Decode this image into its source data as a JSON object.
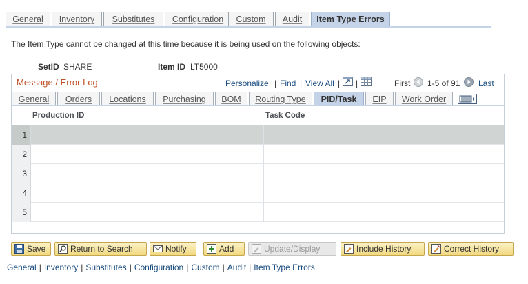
{
  "page_tabs": [
    "General",
    "Inventory",
    "Substitutes",
    "Configuration",
    "Custom",
    "Audit",
    "Item Type Errors"
  ],
  "active_page_tab": "Item Type Errors",
  "intro_text": "The Item Type cannot be changed at this time because it is being used on the following objects:",
  "setid": {
    "label": "SetID",
    "value": "SHARE"
  },
  "item_id": {
    "label": "Item ID",
    "value": "LT5000"
  },
  "grid": {
    "title": "Message / Error Log",
    "personalize": "Personalize",
    "find": "Find",
    "view_all": "View All",
    "first": "First",
    "range": "1-5 of 91",
    "last": "Last",
    "tabs": [
      "General",
      "Orders",
      "Locations",
      "Purchasing",
      "BOM",
      "Routing Type",
      "PID/Task",
      "EIP",
      "Work Order"
    ],
    "active_tab": "PID/Task",
    "columns": [
      "Production ID",
      "Task Code"
    ],
    "rows": [
      {
        "num": "1",
        "production_id": "",
        "task_code": ""
      },
      {
        "num": "2",
        "production_id": "",
        "task_code": ""
      },
      {
        "num": "3",
        "production_id": "",
        "task_code": ""
      },
      {
        "num": "4",
        "production_id": "",
        "task_code": ""
      },
      {
        "num": "5",
        "production_id": "",
        "task_code": ""
      }
    ]
  },
  "toolbar": {
    "save": "Save",
    "return_to_search": "Return to Search",
    "notify": "Notify",
    "add": "Add",
    "update_display": "Update/Display",
    "include_history": "Include History",
    "correct_history": "Correct History"
  },
  "bottom_links": [
    "General",
    "Inventory",
    "Substitutes",
    "Configuration",
    "Custom",
    "Audit",
    "Item Type Errors"
  ],
  "colors": {
    "link": "#1a4d80",
    "grid_title": "#c0532a",
    "active_tab": "#c4d3e7",
    "button": "#f2d97f"
  }
}
